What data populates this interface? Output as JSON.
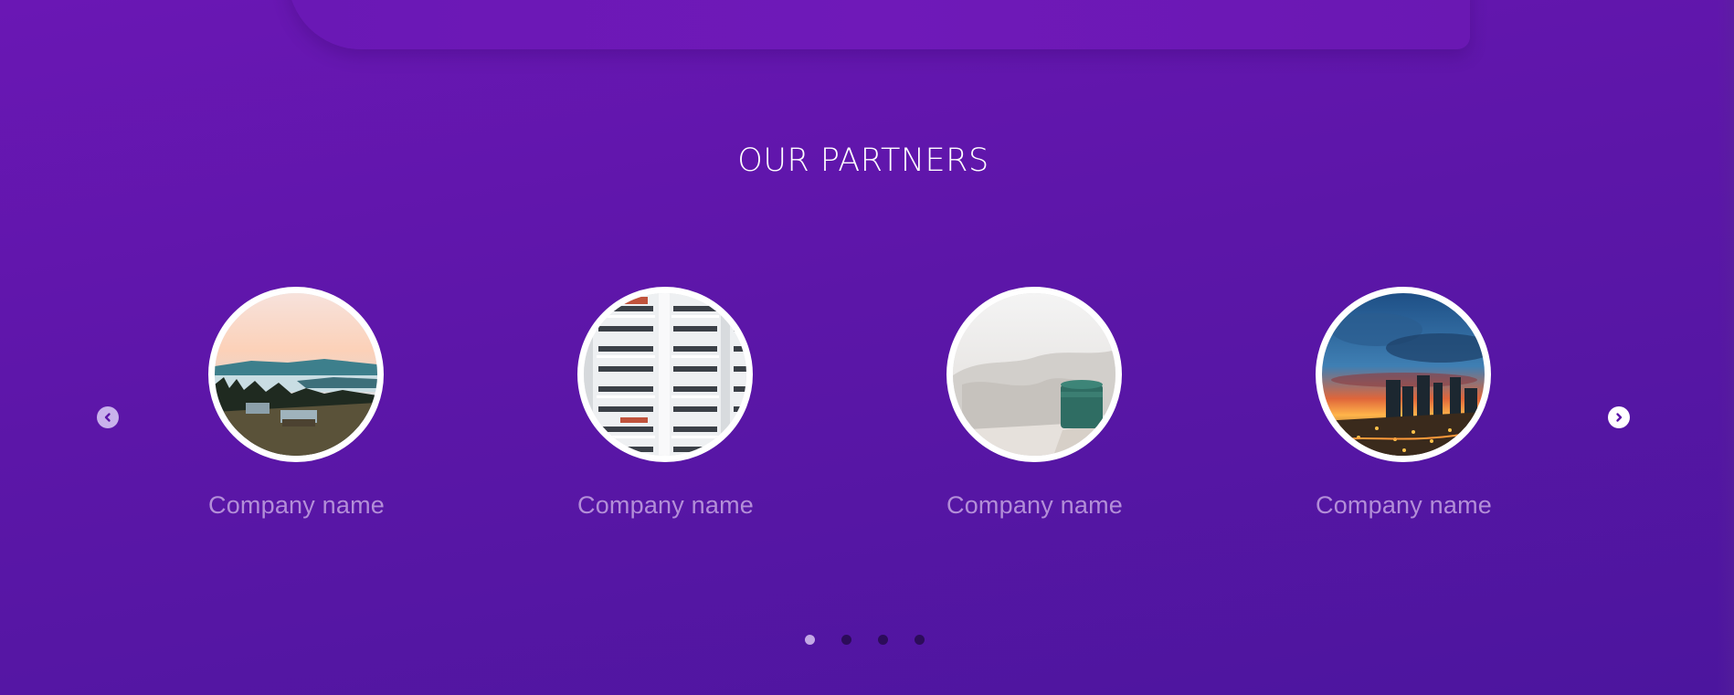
{
  "section": {
    "title": "OUR PARTNERS"
  },
  "partners": [
    {
      "name": "Company name",
      "image": "mountain-cabin-landscape"
    },
    {
      "name": "Company name",
      "image": "white-apartment-building"
    },
    {
      "name": "Company name",
      "image": "bed-with-green-mug"
    },
    {
      "name": "Company name",
      "image": "city-skyline-sunset"
    }
  ],
  "carousel": {
    "prev_icon": "chevron-left-icon",
    "next_icon": "chevron-right-icon",
    "page_count": 4,
    "active_page": 1
  },
  "colors": {
    "background": "#5c16a8",
    "name_text": "#b38ed8",
    "dot_inactive": "#2c0c5a",
    "dot_active": "#c3a8e6"
  }
}
